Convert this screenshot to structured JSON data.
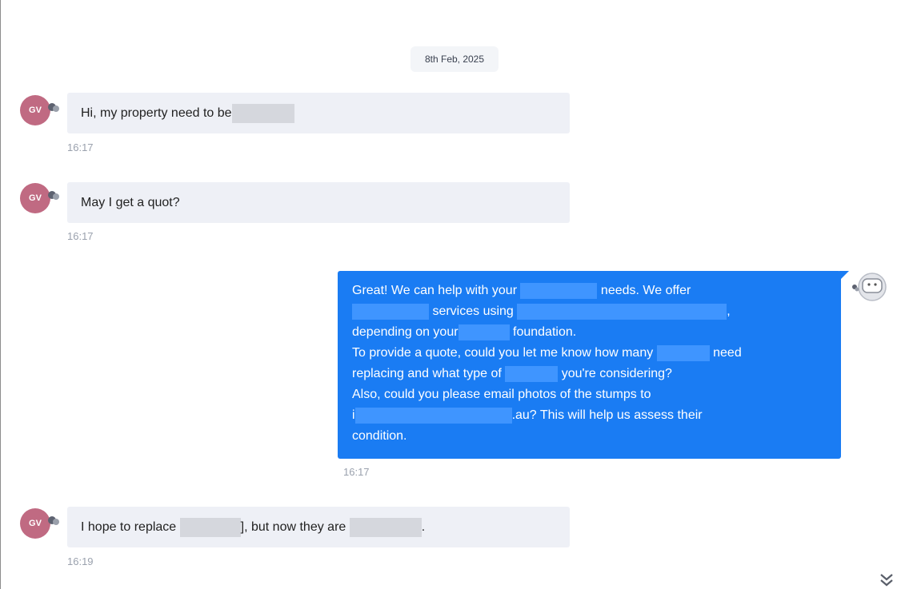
{
  "date_separator": "8th Feb, 2025",
  "messages": [
    {
      "avatar": "GV",
      "text_before": "Hi, my property need to be",
      "text_after": "",
      "time": "16:17"
    },
    {
      "avatar": "GV",
      "text": "May I get a quot?",
      "time": "16:17"
    },
    {
      "lines": {
        "l1a": "Great! We can help with your",
        "l1b": " needs. We offer",
        "l2a": " services using",
        "l2b": ",",
        "l3a": "depending on your",
        "l3b": " foundation.",
        "l4a": "To provide a quote, could you let me know how many",
        "l4b": " need",
        "l5a": "replacing and what type of",
        "l5b": " you're considering?",
        "l6": "Also, could you please email photos of the stumps to",
        "l7a": "i",
        "l7b": ".au? This will help us assess their",
        "l8": "condition."
      },
      "time": "16:17"
    },
    {
      "avatar": "GV",
      "text_before": "I hope to replace",
      "text_mid": "], but now they are",
      "text_after": ".",
      "time": "16:19"
    }
  ],
  "icons": {
    "user_badge": "chat-bubble-icon",
    "bot": "bot-icon",
    "scroll": "double-chevron-down-icon"
  }
}
